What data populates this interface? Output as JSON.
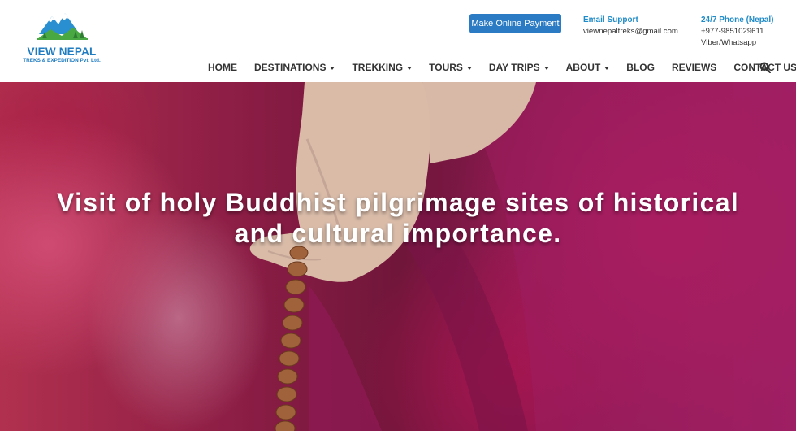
{
  "brand": {
    "name": "VIEW NEPAL",
    "subtitle": "TREKS & EXPEDITION Pvt. Ltd.",
    "colors": {
      "primary": "#1f7cc1",
      "mountain": "#2a8fd0",
      "tree": "#4aa843"
    }
  },
  "header": {
    "payment_button": "Make Online Payment",
    "email": {
      "title": "Email Support",
      "address": "viewnepaltreks@gmail.com"
    },
    "phone": {
      "title": "24/7 Phone (Nepal)",
      "number": "+977-9851029611",
      "apps": "Viber/Whatsapp"
    }
  },
  "nav": {
    "items": [
      {
        "label": "HOME",
        "dropdown": false
      },
      {
        "label": "DESTINATIONS",
        "dropdown": true
      },
      {
        "label": "TREKKING",
        "dropdown": true
      },
      {
        "label": "TOURS",
        "dropdown": true
      },
      {
        "label": "DAY TRIPS",
        "dropdown": true
      },
      {
        "label": "ABOUT",
        "dropdown": true
      },
      {
        "label": "BLOG",
        "dropdown": false
      },
      {
        "label": "REVIEWS",
        "dropdown": false
      },
      {
        "label": "CONTACT US",
        "dropdown": false
      }
    ],
    "search_icon": "search-icon"
  },
  "hero": {
    "title_line1": "Visit of holy Buddhist pilgrimage sites of historical",
    "title_line2": "and cultural importance."
  }
}
